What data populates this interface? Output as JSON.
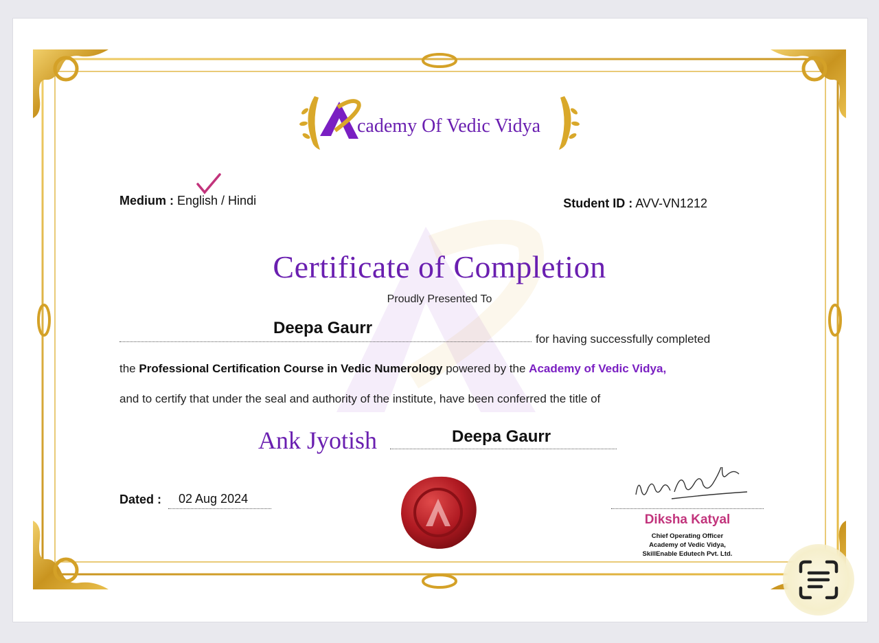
{
  "logo": {
    "text": "cademy Of Vedic Vidya",
    "letter": "A"
  },
  "medium": {
    "label": "Medium :",
    "options": "English / Hindi",
    "selected": "English"
  },
  "student": {
    "label": "Student ID :",
    "value": "AVV-VN1212"
  },
  "title": "Certificate of Completion",
  "presented": "Proudly Presented To",
  "recipient": "Deepa Gaurr",
  "body": {
    "line_a": "for having successfully completed",
    "line_b_pre": "the ",
    "course": "Professional Certification Course in Vedic Numerology",
    "line_b_mid": " powered by the ",
    "institute": "Academy of Vedic Vidya,",
    "line_c": "and to certify that under the seal and authority of the institute, have been conferred the title of"
  },
  "title_conferred": "Ank Jyotish",
  "recipient_repeat": "Deepa Gaurr",
  "dated": {
    "label": "Dated :",
    "value": "02 Aug 2024"
  },
  "signatory": {
    "signature_text": "Diksha Katyal",
    "name": "Diksha Katyal",
    "role": "Chief Operating Officer",
    "org1": "Academy of Vedic Vidya,",
    "org2": "SkillEnable Edutech Pvt. Ltd."
  },
  "colors": {
    "brand_purple": "#6a1fb0",
    "gold": "#d9a82a",
    "signer_pink": "#c2347c",
    "seal_red": "#b01a22"
  },
  "icons": {
    "scan": "live-text-scan-icon",
    "check": "checkmark-icon"
  }
}
